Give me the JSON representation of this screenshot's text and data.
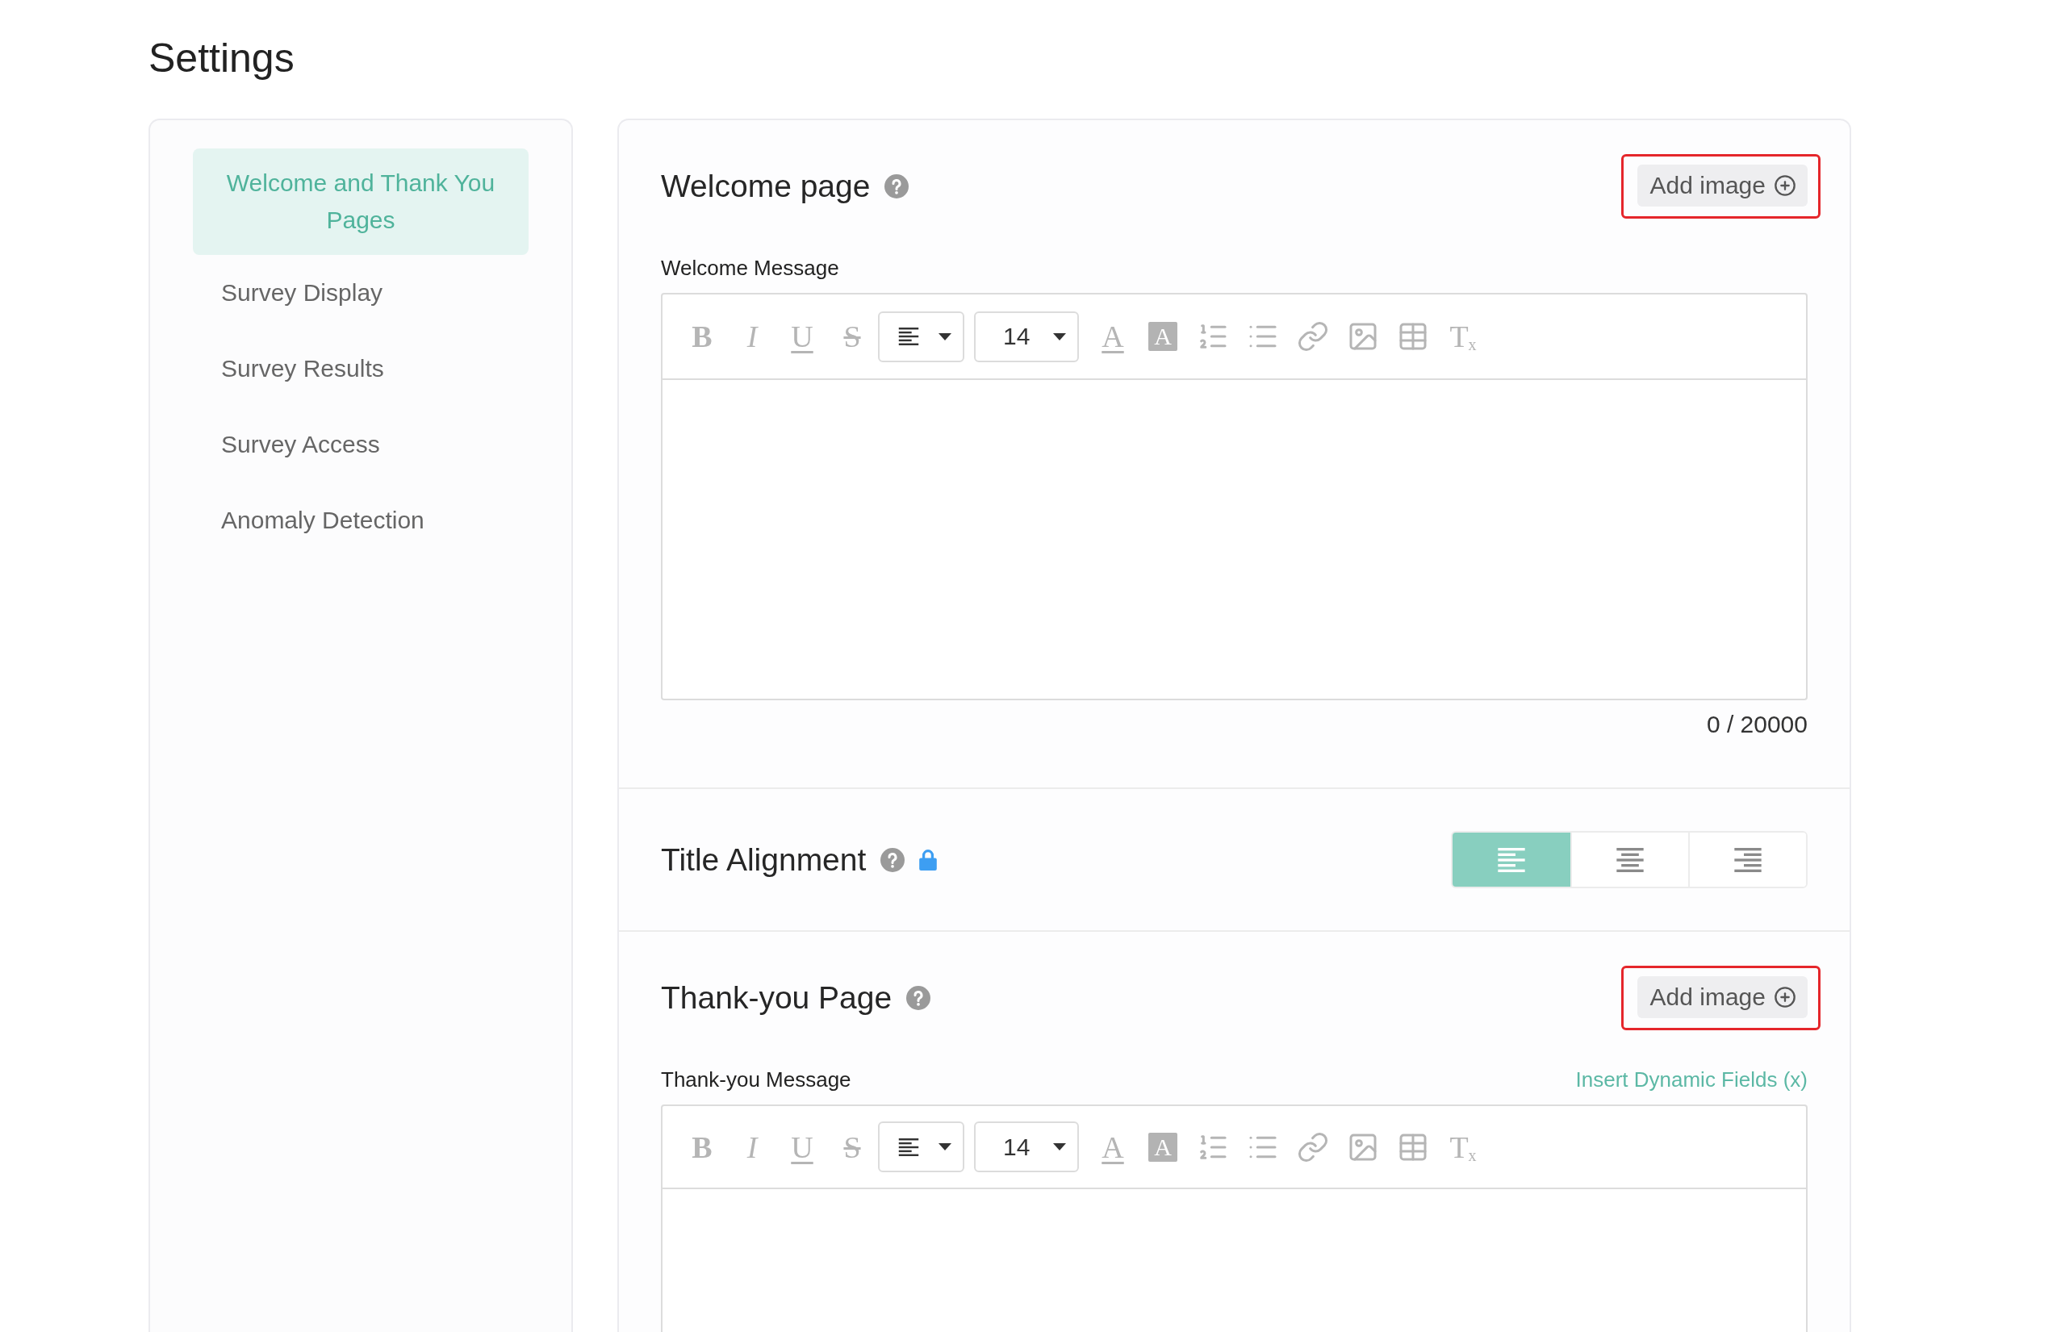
{
  "page": {
    "title": "Settings"
  },
  "sidebar": {
    "items": [
      {
        "label": "Welcome and Thank You Pages",
        "selected": true
      },
      {
        "label": "Survey Display",
        "selected": false
      },
      {
        "label": "Survey Results",
        "selected": false
      },
      {
        "label": "Survey Access",
        "selected": false
      },
      {
        "label": "Anomaly Detection",
        "selected": false
      }
    ]
  },
  "sections": [
    {
      "kind": "editor",
      "title": "Welcome page",
      "help": true,
      "add_image": {
        "label": "Add image",
        "highlighted": true
      },
      "field": {
        "label": "Welcome Message"
      },
      "toolbar": [
        {
          "kind": "bold",
          "label": "B"
        },
        {
          "kind": "italic",
          "label": "I"
        },
        {
          "kind": "underline",
          "label": "U"
        },
        {
          "kind": "strike",
          "label": "S"
        },
        {
          "kind": "align"
        },
        {
          "kind": "size",
          "value": "14"
        },
        {
          "kind": "text-color",
          "label": "A"
        },
        {
          "kind": "highlight",
          "label": "A"
        },
        {
          "kind": "numbered-list"
        },
        {
          "kind": "bullet-list"
        },
        {
          "kind": "link"
        },
        {
          "kind": "image"
        },
        {
          "kind": "table"
        },
        {
          "kind": "clear",
          "label": "T$_{x}$"
        }
      ],
      "counter": "0 / 20000"
    },
    {
      "kind": "alignment",
      "title": "Title Alignment",
      "help": true,
      "locked": true,
      "options": [
        {
          "kind": "left",
          "selected": true
        },
        {
          "kind": "center",
          "selected": false
        },
        {
          "kind": "right",
          "selected": false
        }
      ]
    },
    {
      "kind": "editor",
      "title": "Thank-you Page",
      "help": true,
      "add_image": {
        "label": "Add image",
        "highlighted": true
      },
      "field": {
        "label": "Thank-you Message",
        "link": "Insert Dynamic Fields (x)"
      },
      "toolbar": [
        {
          "kind": "bold",
          "label": "B"
        },
        {
          "kind": "italic",
          "label": "I"
        },
        {
          "kind": "underline",
          "label": "U"
        },
        {
          "kind": "strike",
          "label": "S"
        },
        {
          "kind": "align"
        },
        {
          "kind": "size",
          "value": "14"
        },
        {
          "kind": "text-color",
          "label": "A"
        },
        {
          "kind": "highlight",
          "label": "A"
        },
        {
          "kind": "numbered-list"
        },
        {
          "kind": "bullet-list"
        },
        {
          "kind": "link"
        },
        {
          "kind": "image"
        },
        {
          "kind": "table"
        },
        {
          "kind": "clear",
          "label": "T$_{x}$"
        }
      ]
    }
  ]
}
